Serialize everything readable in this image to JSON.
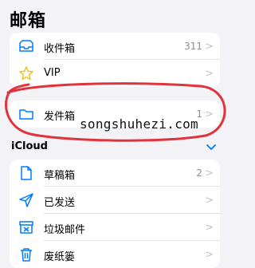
{
  "page": {
    "title": "邮箱"
  },
  "mailboxes": [
    {
      "label": "收件箱",
      "count": "311",
      "icon": "inbox-icon"
    },
    {
      "label": "VIP",
      "count": "",
      "icon": "star-icon"
    }
  ],
  "sent_card": {
    "label": "发件箱",
    "count": "1",
    "icon": "folder-icon"
  },
  "icloud": {
    "title": "iCloud",
    "items": [
      {
        "label": "草稿箱",
        "count": "2",
        "icon": "draft-icon"
      },
      {
        "label": "已发送",
        "count": "",
        "icon": "paper-plane-icon"
      },
      {
        "label": "垃圾邮件",
        "count": "",
        "icon": "junk-icon"
      },
      {
        "label": "废纸篓",
        "count": "",
        "icon": "trash-icon"
      }
    ]
  },
  "watermark": "songshuhezi.com",
  "colors": {
    "accent": "#007aff",
    "annotation": "#e0333c",
    "background": "#f2f2f7"
  },
  "chevron": ">"
}
